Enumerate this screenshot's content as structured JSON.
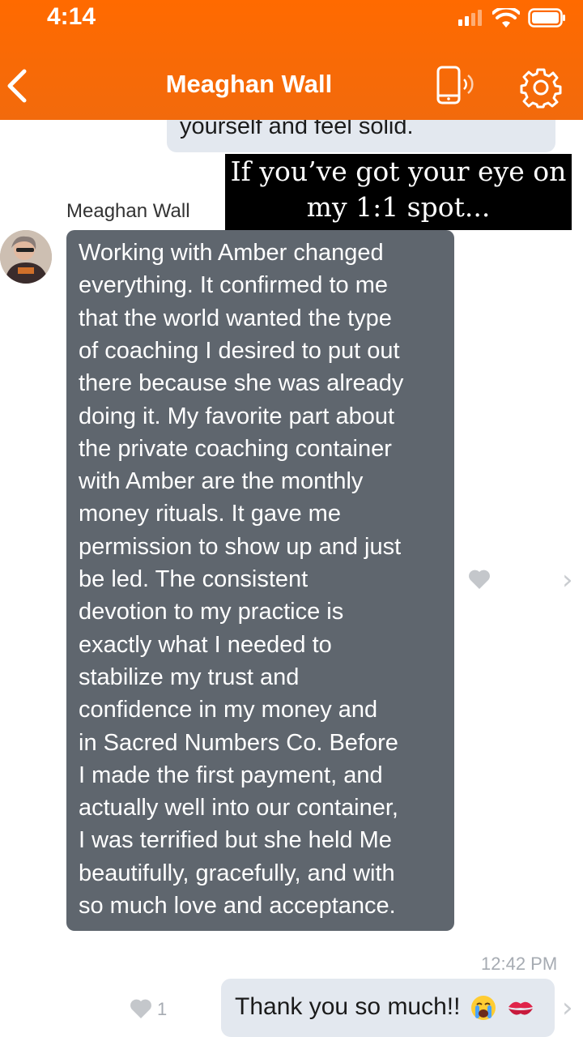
{
  "status_bar": {
    "time": "4:14"
  },
  "header": {
    "title": "Meaghan Wall"
  },
  "previous_message": {
    "text": "yourself and feel solid."
  },
  "overlay": {
    "line1": "If you’ve got your eye on",
    "line2": "my 1:1 spot..."
  },
  "message": {
    "sender": "Meaghan Wall",
    "lines": [
      "Working with Amber changed",
      "everything. It confirmed to me",
      "that the world wanted the type",
      "of coaching I desired to put out",
      "there because she was already",
      "doing it. My favorite part about",
      "the private coaching container",
      "with Amber are the monthly",
      "money rituals. It gave me",
      "permission to show up and just",
      "be led. The consistent",
      "devotion to my practice is",
      "exactly what I needed to",
      "stabilize my trust and",
      "confidence in my money and",
      "in Sacred Numbers Co. Before",
      "I made the first payment, and",
      "actually well into our container,",
      "I was terrified but she held Me",
      "beautifully, gracefully, and with",
      "so much love and acceptance."
    ]
  },
  "reply": {
    "timestamp": "12:42 PM",
    "text": "Thank you so much!!",
    "like_count": "1"
  },
  "icons": {
    "back": "chevron-left-icon",
    "phone": "phone-icon",
    "settings": "gear-icon",
    "heart": "heart-icon",
    "crying": "crying-face-icon",
    "kiss": "kiss-mark-icon"
  },
  "colors": {
    "accent": "#ff6a00",
    "incoming_bubble": "#5f666e",
    "outgoing_bubble": "#e3e8ef"
  }
}
